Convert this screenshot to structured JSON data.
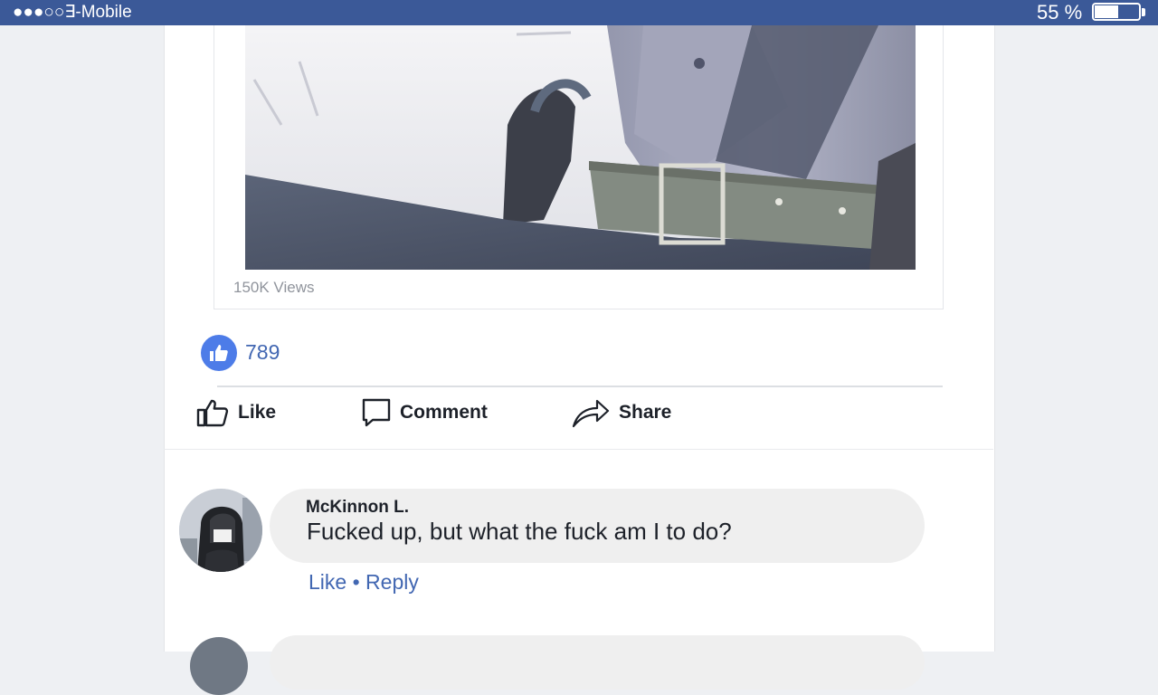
{
  "status_bar": {
    "carrier": "●●●○○∃-Mobile",
    "battery_percent": "55 %",
    "battery_level": 0.55,
    "bg_color": "#3b5998"
  },
  "post": {
    "views": "150K Views",
    "like_count": "789",
    "actions": {
      "like": "Like",
      "comment": "Comment",
      "share": "Share"
    }
  },
  "comments": [
    {
      "author": "McKinnon L.",
      "text": "Fucked up, but what the fuck am I to do?",
      "like_label": "Like",
      "separator": "•",
      "reply_label": "Reply"
    }
  ],
  "colors": {
    "link": "#4267b2",
    "like_badge": "#4d7ce8",
    "text": "#1d2129",
    "muted": "#90949c"
  },
  "icons": {
    "like_badge": "thumbs-up-icon",
    "like_action": "thumbs-up-outline-icon",
    "comment_action": "speech-bubble-icon",
    "share_action": "share-arrow-icon"
  }
}
